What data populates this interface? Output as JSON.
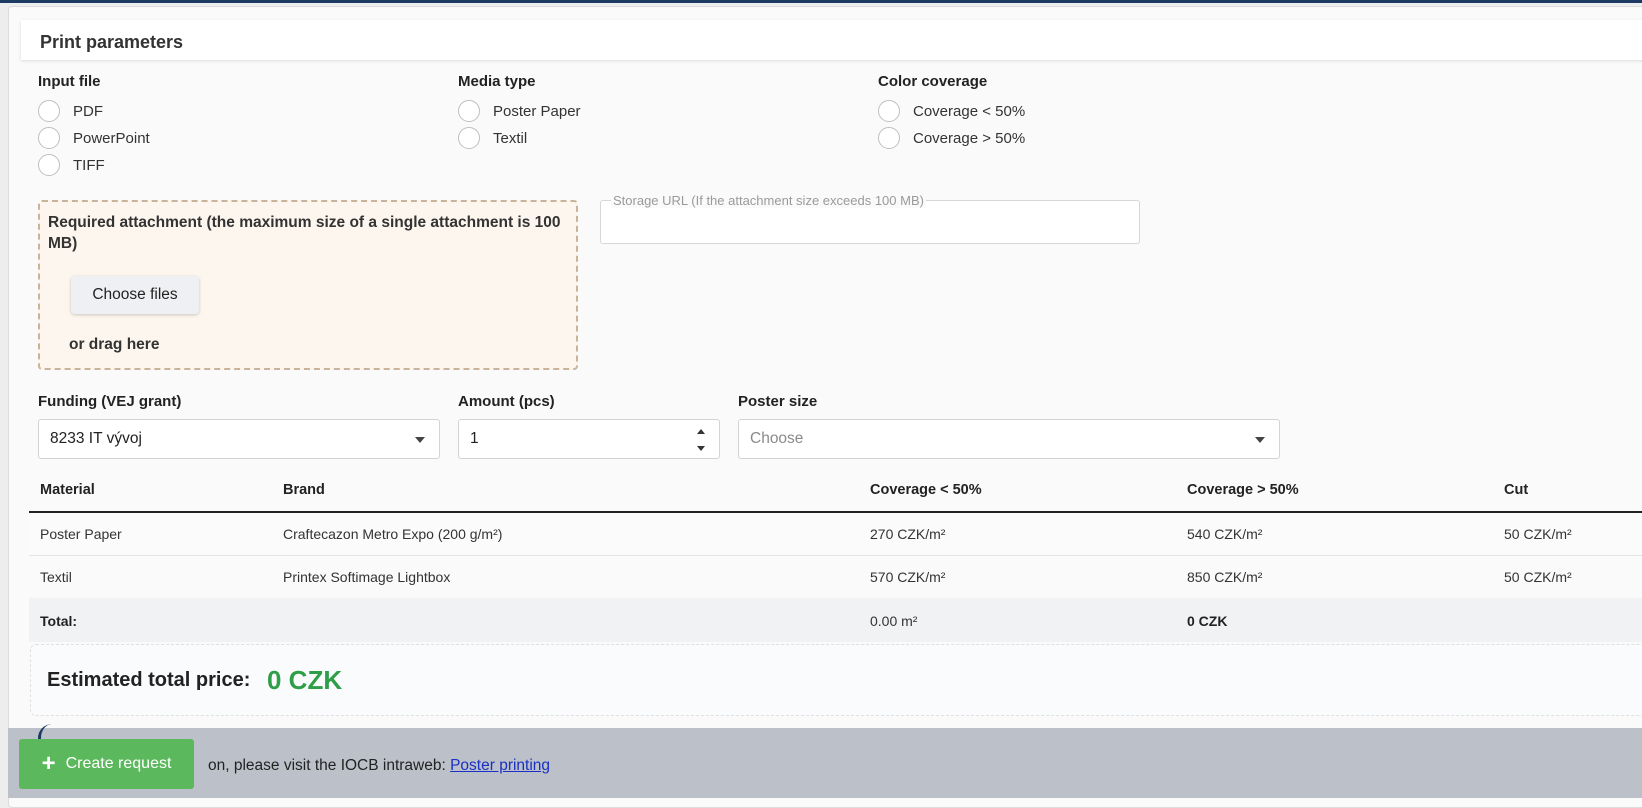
{
  "section_title": "Print parameters",
  "input_file": {
    "title": "Input file",
    "options": [
      "PDF",
      "PowerPoint",
      "TIFF"
    ]
  },
  "media_type": {
    "title": "Media type",
    "options": [
      "Poster Paper",
      "Textil"
    ]
  },
  "color_coverage": {
    "title": "Color coverage",
    "options": [
      "Coverage < 50%",
      "Coverage > 50%"
    ]
  },
  "attachment": {
    "text": "Required attachment (the maximum size of a single attachment is 100 MB)",
    "button_label": "Choose files",
    "drag_text": "or drag here"
  },
  "storage_url": {
    "label": "Storage URL (If the attachment size exceeds 100 MB)",
    "value": ""
  },
  "funding": {
    "label": "Funding (VEJ grant)",
    "value": "8233 IT vývoj"
  },
  "amount": {
    "label": "Amount (pcs)",
    "value": "1"
  },
  "poster_size": {
    "label": "Poster size",
    "placeholder": "Choose"
  },
  "table": {
    "headers": [
      "Material",
      "Brand",
      "Coverage < 50%",
      "Coverage > 50%",
      "Cut"
    ],
    "rows": [
      [
        "Poster Paper",
        "Craftecazon Metro Expo (200 g/m²)",
        "270 CZK/m²",
        "540 CZK/m²",
        "50 CZK/m²"
      ],
      [
        "Textil",
        "Printex Softimage Lightbox",
        "570 CZK/m²",
        "850 CZK/m²",
        "50 CZK/m²"
      ]
    ],
    "total": {
      "label": "Total:",
      "area": "0.00 m²",
      "price": "0 CZK"
    }
  },
  "estimated": {
    "label": "Estimated total price:",
    "value": "0 CZK"
  },
  "footer": {
    "text_visible": "on, please visit the IOCB intraweb: ",
    "link_text": "Poster printing"
  },
  "create_button": {
    "icon": "plus-icon",
    "label": "Create request"
  },
  "colors": {
    "accent_green": "#5cb85c",
    "price_green": "#2e9e47",
    "top_bar": "#1c3a63",
    "link": "#1a2fc4"
  }
}
